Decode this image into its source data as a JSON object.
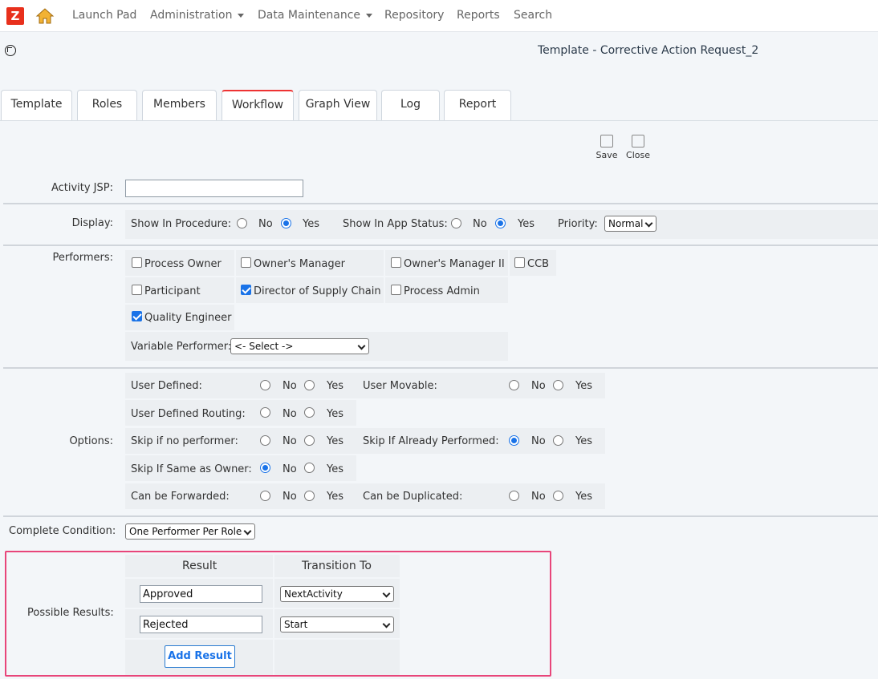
{
  "nav": {
    "logo": "Z",
    "items": [
      "Launch Pad",
      "Administration",
      "Data Maintenance",
      "Repository",
      "Reports",
      "Search"
    ]
  },
  "page_title": "Template - Corrective Action Request_2",
  "tabs": [
    "Template",
    "Roles",
    "Members",
    "Workflow",
    "Graph View",
    "Log",
    "Report"
  ],
  "active_tab": "Workflow",
  "toolbar": {
    "save": "Save",
    "close": "Close"
  },
  "activity_jsp": {
    "label": "Activity JSP:",
    "value": ""
  },
  "display": {
    "label": "Display:",
    "show_in_procedure": "Show In Procedure:",
    "show_in_app_status": "Show In App Status:",
    "no": "No",
    "yes": "Yes",
    "priority_label": "Priority:",
    "priority_value": "Normal"
  },
  "performers": {
    "label": "Performers:",
    "items": [
      {
        "label": "Process Owner",
        "checked": false
      },
      {
        "label": "Owner's Manager",
        "checked": false
      },
      {
        "label": "Owner's Manager II",
        "checked": false
      },
      {
        "label": "CCB",
        "checked": false
      },
      {
        "label": "Participant",
        "checked": false
      },
      {
        "label": "Director of Supply Chain",
        "checked": true
      },
      {
        "label": "Process Admin",
        "checked": false
      },
      {
        "label": "Quality Engineer",
        "checked": true
      }
    ],
    "variable_label": "Variable Performer:",
    "variable_value": "<- Select ->"
  },
  "options": {
    "label": "Options:",
    "no": "No",
    "yes": "Yes",
    "items": [
      {
        "label": "User Defined:",
        "value": "none"
      },
      {
        "label": "User Movable:",
        "value": "none"
      },
      {
        "label": "User Defined Routing:",
        "value": "none"
      },
      {
        "label": "Skip if no performer:",
        "value": "none"
      },
      {
        "label": "Skip If Already Performed:",
        "value": "No"
      },
      {
        "label": "Skip If Same as Owner:",
        "value": "No"
      },
      {
        "label": "Can be Forwarded:",
        "value": "none"
      },
      {
        "label": "Can be Duplicated:",
        "value": "none"
      }
    ]
  },
  "complete_condition": {
    "label": "Complete Condition:",
    "value": "One Performer Per Role"
  },
  "possible_results": {
    "label": "Possible Results:",
    "col_result": "Result",
    "col_transition": "Transition To",
    "rows": [
      {
        "result": "Approved",
        "transition": "NextActivity"
      },
      {
        "result": "Rejected",
        "transition": "Start"
      }
    ],
    "add_button": "Add Result"
  }
}
